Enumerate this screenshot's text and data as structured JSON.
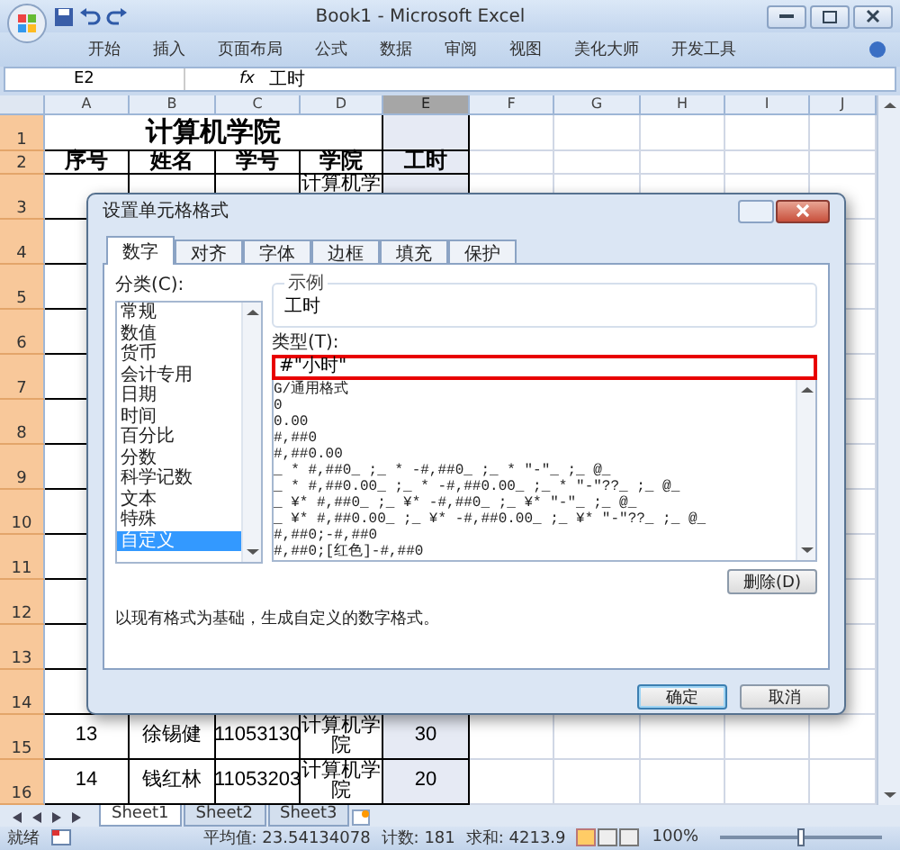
{
  "window": {
    "title": "Book1 - Microsoft Excel"
  },
  "ribbon_tabs": [
    {
      "label": "开始"
    },
    {
      "label": "插入"
    },
    {
      "label": "页面布局"
    },
    {
      "label": "公式"
    },
    {
      "label": "数据"
    },
    {
      "label": "审阅"
    },
    {
      "label": "视图"
    },
    {
      "label": "美化大师"
    },
    {
      "label": "开发工具"
    }
  ],
  "formula_bar": {
    "name_box": "E2",
    "fx": "fx",
    "value": "工时"
  },
  "sheet": {
    "columns": [
      {
        "label": "A",
        "selected": false
      },
      {
        "label": "B",
        "selected": false
      },
      {
        "label": "C",
        "selected": false
      },
      {
        "label": "D",
        "selected": false
      },
      {
        "label": "E",
        "selected": true
      },
      {
        "label": "F",
        "selected": false
      },
      {
        "label": "G",
        "selected": false
      },
      {
        "label": "H",
        "selected": false
      },
      {
        "label": "I",
        "selected": false
      },
      {
        "label": "J",
        "selected": false
      }
    ],
    "rows": [
      {
        "number": "1",
        "kind": "title",
        "highlighted": true,
        "title": "计算机学院"
      },
      {
        "number": "2",
        "kind": "header",
        "highlighted": true,
        "cells": [
          "序号",
          "姓名",
          "学号",
          "学院",
          "工时"
        ]
      },
      {
        "number": "3",
        "kind": "data",
        "highlighted": true,
        "column_d": "计算机学"
      },
      {
        "number": "4",
        "kind": "data",
        "highlighted": true
      },
      {
        "number": "5",
        "kind": "data",
        "highlighted": true
      },
      {
        "number": "6",
        "kind": "data",
        "highlighted": true
      },
      {
        "number": "7",
        "kind": "data",
        "highlighted": true
      },
      {
        "number": "8",
        "kind": "data",
        "highlighted": true
      },
      {
        "number": "9",
        "kind": "data",
        "highlighted": true
      },
      {
        "number": "10",
        "kind": "data",
        "highlighted": true
      },
      {
        "number": "11",
        "kind": "data",
        "highlighted": true
      },
      {
        "number": "12",
        "kind": "data",
        "highlighted": true
      },
      {
        "number": "13",
        "kind": "data",
        "highlighted": true
      },
      {
        "number": "14",
        "kind": "data",
        "highlighted": true
      },
      {
        "number": "15",
        "kind": "data",
        "highlighted": true,
        "cells": [
          "13",
          "徐锡健",
          "11053130",
          "计算机学院",
          "30"
        ]
      },
      {
        "number": "16",
        "kind": "data",
        "highlighted": true,
        "cells": [
          "14",
          "钱红林",
          "11053203",
          "计算机学院",
          "20"
        ]
      }
    ]
  },
  "sheet_tabs": [
    {
      "label": "Sheet1",
      "selected": true
    },
    {
      "label": "Sheet2",
      "selected": false
    },
    {
      "label": "Sheet3",
      "selected": false
    }
  ],
  "status_bar": {
    "state": "就绪",
    "average": "平均值: 23.54134078",
    "count": "计数: 181",
    "sum": "求和: 4213.9",
    "zoom": "100%",
    "zoom_level": {
      "level": 0.5
    }
  },
  "dialog": {
    "title": "设置单元格格式",
    "tabs": [
      {
        "label": "数字",
        "selected": true
      },
      {
        "label": "对齐",
        "selected": false
      },
      {
        "label": "字体",
        "selected": false
      },
      {
        "label": "边框",
        "selected": false
      },
      {
        "label": "填充",
        "selected": false
      },
      {
        "label": "保护",
        "selected": false
      }
    ],
    "category_label": "分类(C):",
    "categories": [
      {
        "label": "常规",
        "selected": false
      },
      {
        "label": "数值",
        "selected": false
      },
      {
        "label": "货币",
        "selected": false
      },
      {
        "label": "会计专用",
        "selected": false
      },
      {
        "label": "日期",
        "selected": false
      },
      {
        "label": "时间",
        "selected": false
      },
      {
        "label": "百分比",
        "selected": false
      },
      {
        "label": "分数",
        "selected": false
      },
      {
        "label": "科学记数",
        "selected": false
      },
      {
        "label": "文本",
        "selected": false
      },
      {
        "label": "特殊",
        "selected": false
      },
      {
        "label": "自定义",
        "selected": true
      }
    ],
    "sample_label": "示例",
    "sample_value": "工时",
    "type_label": "类型(T):",
    "type_value": "#\"小时\"",
    "formats": [
      "G/通用格式",
      "0",
      "0.00",
      "#,##0",
      "#,##0.00",
      "_ * #,##0_ ;_ * -#,##0_ ;_ * \"-\"_ ;_ @_",
      "_ * #,##0.00_ ;_ * -#,##0.00_ ;_ * \"-\"??_ ;_ @_",
      "_ ¥* #,##0_ ;_ ¥* -#,##0_ ;_ ¥* \"-\"_ ;_ @_",
      "_ ¥* #,##0.00_ ;_ ¥* -#,##0.00_ ;_ ¥* \"-\"??_ ;_ @_",
      "#,##0;-#,##0",
      "#,##0;[红色]-#,##0"
    ],
    "delete_button": "删除(D)",
    "description": "以现有格式为基础，生成自定义的数字格式。",
    "buttons": [
      {
        "label": "确定",
        "kind": "default"
      },
      {
        "label": "取消",
        "kind": "normal"
      }
    ]
  }
}
